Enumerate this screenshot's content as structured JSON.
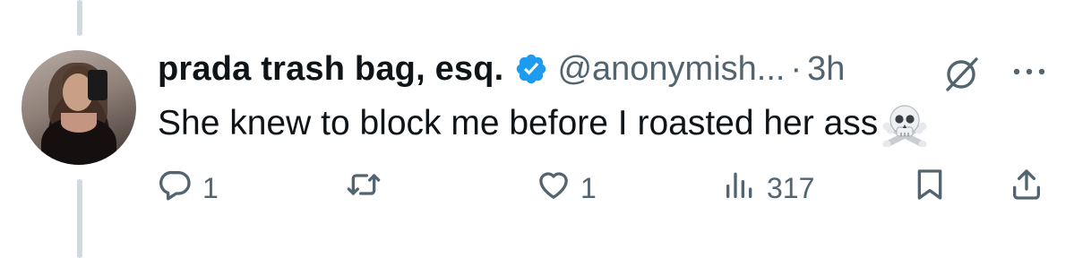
{
  "tweet": {
    "author_name": "prada trash bag, esq.",
    "handle": "@anonymish...",
    "separator": "·",
    "time": "3h",
    "verified": true,
    "text": "She knew to block me before I roasted her ass",
    "emoji": "skull-and-crossbones",
    "accent_color": "#1d9bf0",
    "muted_color": "#536471"
  },
  "actions": {
    "replies": "1",
    "retweets": "",
    "likes": "1",
    "views": "317"
  },
  "icons": [
    "verified-badge-icon",
    "grok-icon",
    "more-icon",
    "reply-icon",
    "retweet-icon",
    "like-icon",
    "views-icon",
    "bookmark-icon",
    "share-icon"
  ]
}
